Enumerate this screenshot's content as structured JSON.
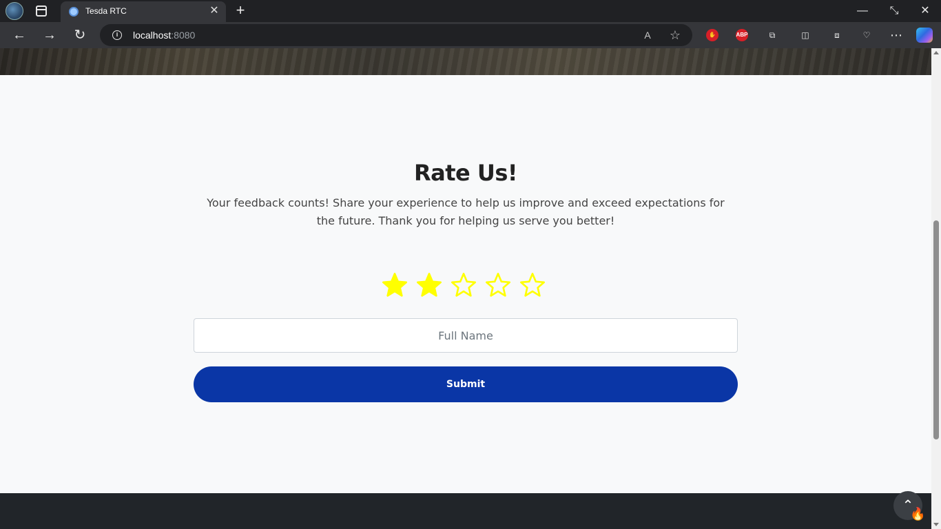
{
  "browser": {
    "tab_title": "Tesda RTC",
    "tab_close": "✕",
    "new_tab": "+",
    "url_host": "localhost",
    "url_port": ":8080",
    "window": {
      "minimize": "—",
      "restore": "⤡",
      "close": "✕"
    },
    "icons": {
      "back": "←",
      "forward": "→",
      "reload": "↻",
      "read_aloud": "A",
      "favorite": "☆",
      "adblock_label": "ABP",
      "more": "⋯"
    }
  },
  "rating": {
    "title": "Rate Us!",
    "description": "Your feedback counts! Share your experience to help us improve and exceed expectations for the future. Thank you for helping us serve you better!",
    "selected": 2,
    "max": 5,
    "star_color": "#ffff00"
  },
  "form": {
    "name_placeholder": "Full Name",
    "name_value": "",
    "submit_label": "Submit"
  },
  "colors": {
    "submit_bg": "#0a36a6",
    "footer_bg": "#212529",
    "page_bg": "#f8f9fa"
  },
  "page": {
    "back_to_top": "⌃"
  }
}
